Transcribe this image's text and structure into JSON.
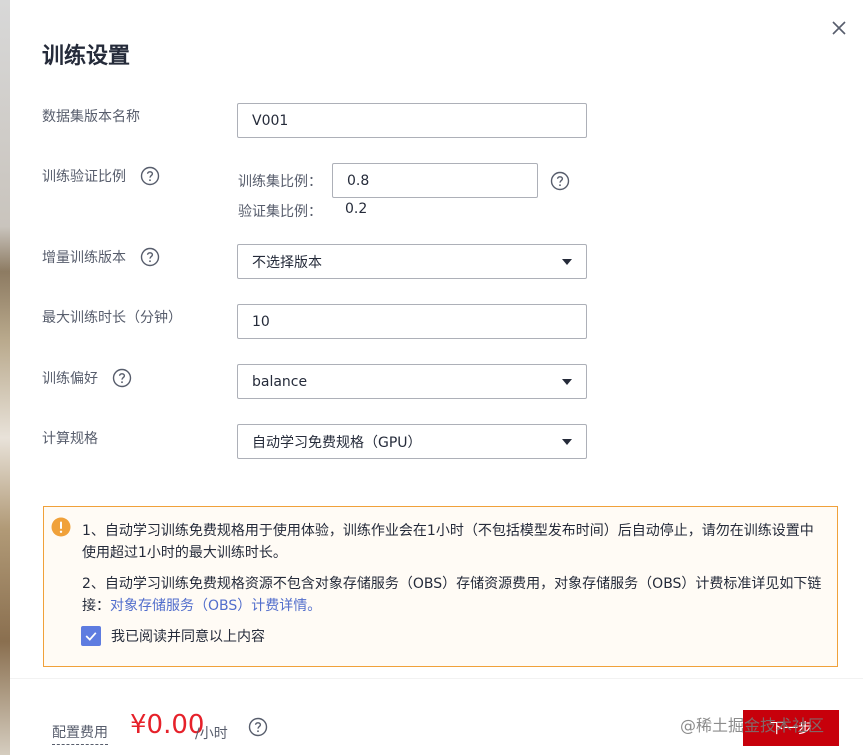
{
  "dialog": {
    "title": "训练设置",
    "close_icon": "close-icon"
  },
  "form": {
    "dataset_version": {
      "label": "数据集版本名称",
      "value": "V001"
    },
    "split": {
      "label": "训练验证比例",
      "train_label": "训练集比例：",
      "train_value": "0.8",
      "val_label": "验证集比例：",
      "val_value": "0.2"
    },
    "incremental": {
      "label": "增量训练版本",
      "value": "不选择版本"
    },
    "max_time": {
      "label": "最大训练时长（分钟）",
      "value": "10"
    },
    "preference": {
      "label": "训练偏好",
      "value": "balance"
    },
    "spec": {
      "label": "计算规格",
      "value": "自动学习免费规格（GPU）"
    }
  },
  "notice": {
    "line1": "1、自动学习训练免费规格用于使用体验，训练作业会在1小时（不包括模型发布时间）后自动停止，请勿在训练设置中使用超过1小时的最大训练时长。",
    "line2_prefix": "2、自动学习训练免费规格资源不包含对象存储服务（OBS）存储资源费用，对象存储服务（OBS）计费标准详见如下链接：",
    "line2_link": "对象存储服务（OBS）计费详情。",
    "agree_label": "我已阅读并同意以上内容",
    "agree_checked": true,
    "border_color": "#f0a13a"
  },
  "footer": {
    "fee_label": "配置费用",
    "fee_value": "¥0.00",
    "fee_unit": "/小时",
    "next_label": "下一步",
    "watermark": "@稀土掘金技术社区",
    "accent_color": "#c7000b",
    "price_color": "#e6212a"
  }
}
